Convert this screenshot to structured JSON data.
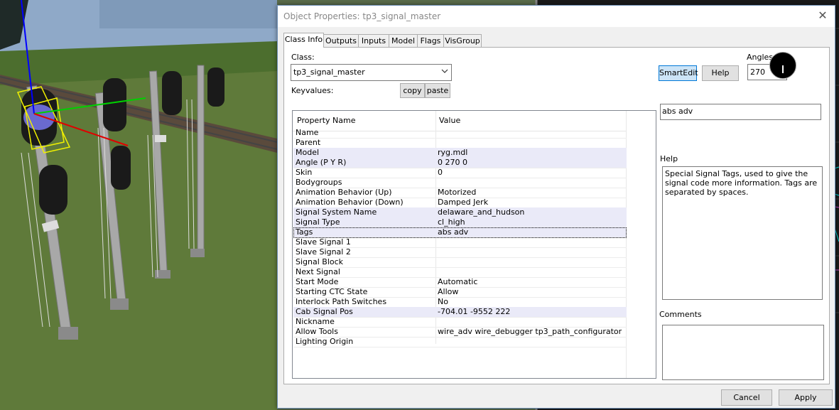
{
  "window": {
    "title": "Object Properties: tp3_signal_master",
    "close_glyph": "✕"
  },
  "tabs": [
    {
      "label": "Class Info",
      "active": true
    },
    {
      "label": "Outputs",
      "active": false
    },
    {
      "label": "Inputs",
      "active": false
    },
    {
      "label": "Model",
      "active": false
    },
    {
      "label": "Flags",
      "active": false
    },
    {
      "label": "VisGroup",
      "active": false
    }
  ],
  "class_info": {
    "class_label": "Class:",
    "class_value": "tp3_signal_master",
    "keyvalues_label": "Keyvalues:",
    "copy_label": "copy",
    "paste_label": "paste",
    "smartedit_label": "SmartEdit",
    "help_button_label": "Help",
    "angles_label": "Angles:",
    "angles_value": "270",
    "selected_value": "abs adv",
    "help_label": "Help",
    "help_text": "Special Signal Tags, used to give the signal code more information. Tags are separated by spaces.",
    "comments_label": "Comments"
  },
  "table": {
    "col_property": "Property Name",
    "col_value": "Value",
    "rows": [
      {
        "key": "Name",
        "value": "",
        "state": "normal"
      },
      {
        "key": "Parent",
        "value": "",
        "state": "normal"
      },
      {
        "key": "Model",
        "value": "ryg.mdl",
        "state": "hl"
      },
      {
        "key": "Angle (P Y R)",
        "value": "0 270 0",
        "state": "hl"
      },
      {
        "key": "Skin",
        "value": "0",
        "state": "normal"
      },
      {
        "key": "Bodygroups",
        "value": "",
        "state": "normal"
      },
      {
        "key": "Animation Behavior (Up)",
        "value": "Motorized",
        "state": "normal"
      },
      {
        "key": "Animation Behavior (Down)",
        "value": "Damped Jerk",
        "state": "normal"
      },
      {
        "key": "Signal System Name",
        "value": "delaware_and_hudson",
        "state": "hl"
      },
      {
        "key": "Signal Type",
        "value": "cl_high",
        "state": "hl"
      },
      {
        "key": "Tags",
        "value": "abs adv",
        "state": "sel"
      },
      {
        "key": "Slave Signal 1",
        "value": "",
        "state": "normal"
      },
      {
        "key": "Slave Signal 2",
        "value": "",
        "state": "normal"
      },
      {
        "key": "Signal Block",
        "value": "",
        "state": "normal"
      },
      {
        "key": "Next Signal",
        "value": "",
        "state": "normal"
      },
      {
        "key": "Start Mode",
        "value": "Automatic",
        "state": "normal"
      },
      {
        "key": "Starting CTC State",
        "value": "Allow",
        "state": "normal"
      },
      {
        "key": "Interlock Path Switches",
        "value": "No",
        "state": "normal"
      },
      {
        "key": "Cab Signal Pos",
        "value": "-704.01 -9552 222",
        "state": "hl"
      },
      {
        "key": "Nickname",
        "value": "",
        "state": "normal"
      },
      {
        "key": "Allow Tools",
        "value": "wire_adv wire_debugger tp3_path_configurator",
        "state": "normal"
      },
      {
        "key": "Lighting Origin",
        "value": "",
        "state": "normal"
      }
    ]
  },
  "footer": {
    "cancel_label": "Cancel",
    "apply_label": "Apply"
  }
}
